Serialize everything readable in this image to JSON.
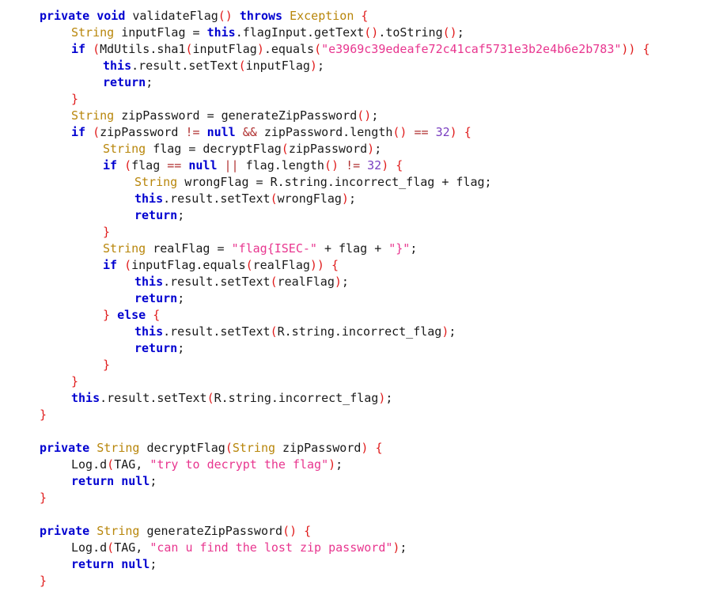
{
  "editor": {
    "language": "java",
    "background": "#ffffff",
    "colors": {
      "keyword": "#0000d0",
      "type": "#b8860b",
      "plain": "#1a1a1a",
      "bracket": "#e01b1b",
      "string": "#e8368f",
      "number": "#7a3fc0",
      "operator": "#b03030"
    }
  },
  "code": {
    "lines": [
      {
        "indent": 0,
        "tokens": [
          {
            "t": "private",
            "c": "kw"
          },
          {
            "t": " ",
            "c": "plain"
          },
          {
            "t": "void",
            "c": "kw"
          },
          {
            "t": " ",
            "c": "plain"
          },
          {
            "t": "validateFlag",
            "c": "plain"
          },
          {
            "t": "()",
            "c": "paren"
          },
          {
            "t": " ",
            "c": "plain"
          },
          {
            "t": "throws",
            "c": "kw"
          },
          {
            "t": " ",
            "c": "plain"
          },
          {
            "t": "Exception",
            "c": "type"
          },
          {
            "t": " ",
            "c": "plain"
          },
          {
            "t": "{",
            "c": "paren"
          }
        ]
      },
      {
        "indent": 1,
        "tokens": [
          {
            "t": "String",
            "c": "type"
          },
          {
            "t": " inputFlag ",
            "c": "plain"
          },
          {
            "t": "=",
            "c": "op"
          },
          {
            "t": " ",
            "c": "plain"
          },
          {
            "t": "this",
            "c": "kw"
          },
          {
            "t": ".flagInput.getText",
            "c": "plain"
          },
          {
            "t": "()",
            "c": "paren"
          },
          {
            "t": ".toString",
            "c": "plain"
          },
          {
            "t": "()",
            "c": "paren"
          },
          {
            "t": ";",
            "c": "op"
          }
        ]
      },
      {
        "indent": 1,
        "tokens": [
          {
            "t": "if",
            "c": "kw"
          },
          {
            "t": " ",
            "c": "plain"
          },
          {
            "t": "(",
            "c": "paren"
          },
          {
            "t": "MdUtils.sha1",
            "c": "plain"
          },
          {
            "t": "(",
            "c": "paren"
          },
          {
            "t": "inputFlag",
            "c": "plain"
          },
          {
            "t": ")",
            "c": "paren"
          },
          {
            "t": ".equals",
            "c": "plain"
          },
          {
            "t": "(",
            "c": "paren"
          },
          {
            "t": "\"e3969c39edeafe72c41caf5731e3b2e4b6e2b783\"",
            "c": "str"
          },
          {
            "t": "))",
            "c": "paren"
          },
          {
            "t": " ",
            "c": "plain"
          },
          {
            "t": "{",
            "c": "paren"
          }
        ]
      },
      {
        "indent": 2,
        "tokens": [
          {
            "t": "this",
            "c": "kw"
          },
          {
            "t": ".result.setText",
            "c": "plain"
          },
          {
            "t": "(",
            "c": "paren"
          },
          {
            "t": "inputFlag",
            "c": "plain"
          },
          {
            "t": ")",
            "c": "paren"
          },
          {
            "t": ";",
            "c": "op"
          }
        ]
      },
      {
        "indent": 2,
        "tokens": [
          {
            "t": "return",
            "c": "kw"
          },
          {
            "t": ";",
            "c": "op"
          }
        ]
      },
      {
        "indent": 1,
        "tokens": [
          {
            "t": "}",
            "c": "paren"
          }
        ]
      },
      {
        "indent": 1,
        "tokens": [
          {
            "t": "String",
            "c": "type"
          },
          {
            "t": " zipPassword ",
            "c": "plain"
          },
          {
            "t": "=",
            "c": "op"
          },
          {
            "t": " generateZipPassword",
            "c": "plain"
          },
          {
            "t": "()",
            "c": "paren"
          },
          {
            "t": ";",
            "c": "op"
          }
        ]
      },
      {
        "indent": 1,
        "tokens": [
          {
            "t": "if",
            "c": "kw"
          },
          {
            "t": " ",
            "c": "plain"
          },
          {
            "t": "(",
            "c": "paren"
          },
          {
            "t": "zipPassword ",
            "c": "plain"
          },
          {
            "t": "!=",
            "c": "opr"
          },
          {
            "t": " ",
            "c": "plain"
          },
          {
            "t": "null",
            "c": "kw"
          },
          {
            "t": " ",
            "c": "plain"
          },
          {
            "t": "&&",
            "c": "opr"
          },
          {
            "t": " zipPassword.length",
            "c": "plain"
          },
          {
            "t": "()",
            "c": "paren"
          },
          {
            "t": " ",
            "c": "plain"
          },
          {
            "t": "==",
            "c": "opr"
          },
          {
            "t": " ",
            "c": "plain"
          },
          {
            "t": "32",
            "c": "num"
          },
          {
            "t": ")",
            "c": "paren"
          },
          {
            "t": " ",
            "c": "plain"
          },
          {
            "t": "{",
            "c": "paren"
          }
        ]
      },
      {
        "indent": 2,
        "tokens": [
          {
            "t": "String",
            "c": "type"
          },
          {
            "t": " flag ",
            "c": "plain"
          },
          {
            "t": "=",
            "c": "op"
          },
          {
            "t": " decryptFlag",
            "c": "plain"
          },
          {
            "t": "(",
            "c": "paren"
          },
          {
            "t": "zipPassword",
            "c": "plain"
          },
          {
            "t": ")",
            "c": "paren"
          },
          {
            "t": ";",
            "c": "op"
          }
        ]
      },
      {
        "indent": 2,
        "tokens": [
          {
            "t": "if",
            "c": "kw"
          },
          {
            "t": " ",
            "c": "plain"
          },
          {
            "t": "(",
            "c": "paren"
          },
          {
            "t": "flag ",
            "c": "plain"
          },
          {
            "t": "==",
            "c": "opr"
          },
          {
            "t": " ",
            "c": "plain"
          },
          {
            "t": "null",
            "c": "kw"
          },
          {
            "t": " ",
            "c": "plain"
          },
          {
            "t": "||",
            "c": "opr"
          },
          {
            "t": " flag.length",
            "c": "plain"
          },
          {
            "t": "()",
            "c": "paren"
          },
          {
            "t": " ",
            "c": "plain"
          },
          {
            "t": "!=",
            "c": "opr"
          },
          {
            "t": " ",
            "c": "plain"
          },
          {
            "t": "32",
            "c": "num"
          },
          {
            "t": ")",
            "c": "paren"
          },
          {
            "t": " ",
            "c": "plain"
          },
          {
            "t": "{",
            "c": "paren"
          }
        ]
      },
      {
        "indent": 3,
        "tokens": [
          {
            "t": "String",
            "c": "type"
          },
          {
            "t": " wrongFlag ",
            "c": "plain"
          },
          {
            "t": "=",
            "c": "op"
          },
          {
            "t": " R.string.incorrect_flag ",
            "c": "plain"
          },
          {
            "t": "+",
            "c": "op"
          },
          {
            "t": " flag",
            "c": "plain"
          },
          {
            "t": ";",
            "c": "op"
          }
        ]
      },
      {
        "indent": 3,
        "tokens": [
          {
            "t": "this",
            "c": "kw"
          },
          {
            "t": ".result.setText",
            "c": "plain"
          },
          {
            "t": "(",
            "c": "paren"
          },
          {
            "t": "wrongFlag",
            "c": "plain"
          },
          {
            "t": ")",
            "c": "paren"
          },
          {
            "t": ";",
            "c": "op"
          }
        ]
      },
      {
        "indent": 3,
        "tokens": [
          {
            "t": "return",
            "c": "kw"
          },
          {
            "t": ";",
            "c": "op"
          }
        ]
      },
      {
        "indent": 2,
        "tokens": [
          {
            "t": "}",
            "c": "paren"
          }
        ]
      },
      {
        "indent": 2,
        "tokens": [
          {
            "t": "String",
            "c": "type"
          },
          {
            "t": " realFlag ",
            "c": "plain"
          },
          {
            "t": "=",
            "c": "op"
          },
          {
            "t": " ",
            "c": "plain"
          },
          {
            "t": "\"flag{ISEC-\"",
            "c": "str"
          },
          {
            "t": " ",
            "c": "plain"
          },
          {
            "t": "+",
            "c": "op"
          },
          {
            "t": " flag ",
            "c": "plain"
          },
          {
            "t": "+",
            "c": "op"
          },
          {
            "t": " ",
            "c": "plain"
          },
          {
            "t": "\"}\"",
            "c": "str"
          },
          {
            "t": ";",
            "c": "op"
          }
        ]
      },
      {
        "indent": 2,
        "tokens": [
          {
            "t": "if",
            "c": "kw"
          },
          {
            "t": " ",
            "c": "plain"
          },
          {
            "t": "(",
            "c": "paren"
          },
          {
            "t": "inputFlag.equals",
            "c": "plain"
          },
          {
            "t": "(",
            "c": "paren"
          },
          {
            "t": "realFlag",
            "c": "plain"
          },
          {
            "t": "))",
            "c": "paren"
          },
          {
            "t": " ",
            "c": "plain"
          },
          {
            "t": "{",
            "c": "paren"
          }
        ]
      },
      {
        "indent": 3,
        "tokens": [
          {
            "t": "this",
            "c": "kw"
          },
          {
            "t": ".result.setText",
            "c": "plain"
          },
          {
            "t": "(",
            "c": "paren"
          },
          {
            "t": "realFlag",
            "c": "plain"
          },
          {
            "t": ")",
            "c": "paren"
          },
          {
            "t": ";",
            "c": "op"
          }
        ]
      },
      {
        "indent": 3,
        "tokens": [
          {
            "t": "return",
            "c": "kw"
          },
          {
            "t": ";",
            "c": "op"
          }
        ]
      },
      {
        "indent": 2,
        "tokens": [
          {
            "t": "}",
            "c": "paren"
          },
          {
            "t": " ",
            "c": "plain"
          },
          {
            "t": "else",
            "c": "kw"
          },
          {
            "t": " ",
            "c": "plain"
          },
          {
            "t": "{",
            "c": "paren"
          }
        ]
      },
      {
        "indent": 3,
        "tokens": [
          {
            "t": "this",
            "c": "kw"
          },
          {
            "t": ".result.setText",
            "c": "plain"
          },
          {
            "t": "(",
            "c": "paren"
          },
          {
            "t": "R.string.incorrect_flag",
            "c": "plain"
          },
          {
            "t": ")",
            "c": "paren"
          },
          {
            "t": ";",
            "c": "op"
          }
        ]
      },
      {
        "indent": 3,
        "tokens": [
          {
            "t": "return",
            "c": "kw"
          },
          {
            "t": ";",
            "c": "op"
          }
        ]
      },
      {
        "indent": 2,
        "tokens": [
          {
            "t": "}",
            "c": "paren"
          }
        ]
      },
      {
        "indent": 1,
        "tokens": [
          {
            "t": "}",
            "c": "paren"
          }
        ]
      },
      {
        "indent": 1,
        "tokens": [
          {
            "t": "this",
            "c": "kw"
          },
          {
            "t": ".result.setText",
            "c": "plain"
          },
          {
            "t": "(",
            "c": "paren"
          },
          {
            "t": "R.string.incorrect_flag",
            "c": "plain"
          },
          {
            "t": ")",
            "c": "paren"
          },
          {
            "t": ";",
            "c": "op"
          }
        ]
      },
      {
        "indent": 0,
        "tokens": [
          {
            "t": "}",
            "c": "paren"
          }
        ]
      },
      {
        "indent": 0,
        "tokens": []
      },
      {
        "indent": 0,
        "tokens": [
          {
            "t": "private",
            "c": "kw"
          },
          {
            "t": " ",
            "c": "plain"
          },
          {
            "t": "String",
            "c": "type"
          },
          {
            "t": " decryptFlag",
            "c": "plain"
          },
          {
            "t": "(",
            "c": "paren"
          },
          {
            "t": "String",
            "c": "type"
          },
          {
            "t": " zipPassword",
            "c": "plain"
          },
          {
            "t": ")",
            "c": "paren"
          },
          {
            "t": " ",
            "c": "plain"
          },
          {
            "t": "{",
            "c": "paren"
          }
        ]
      },
      {
        "indent": 1,
        "tokens": [
          {
            "t": "Log.d",
            "c": "plain"
          },
          {
            "t": "(",
            "c": "paren"
          },
          {
            "t": "TAG",
            "c": "plain"
          },
          {
            "t": ",",
            "c": "op"
          },
          {
            "t": " ",
            "c": "plain"
          },
          {
            "t": "\"try to decrypt the flag\"",
            "c": "str"
          },
          {
            "t": ")",
            "c": "paren"
          },
          {
            "t": ";",
            "c": "op"
          }
        ]
      },
      {
        "indent": 1,
        "tokens": [
          {
            "t": "return",
            "c": "kw"
          },
          {
            "t": " ",
            "c": "plain"
          },
          {
            "t": "null",
            "c": "kw"
          },
          {
            "t": ";",
            "c": "op"
          }
        ]
      },
      {
        "indent": 0,
        "tokens": [
          {
            "t": "}",
            "c": "paren"
          }
        ]
      },
      {
        "indent": 0,
        "tokens": []
      },
      {
        "indent": 0,
        "tokens": [
          {
            "t": "private",
            "c": "kw"
          },
          {
            "t": " ",
            "c": "plain"
          },
          {
            "t": "String",
            "c": "type"
          },
          {
            "t": " generateZipPassword",
            "c": "plain"
          },
          {
            "t": "()",
            "c": "paren"
          },
          {
            "t": " ",
            "c": "plain"
          },
          {
            "t": "{",
            "c": "paren"
          }
        ]
      },
      {
        "indent": 1,
        "tokens": [
          {
            "t": "Log.d",
            "c": "plain"
          },
          {
            "t": "(",
            "c": "paren"
          },
          {
            "t": "TAG",
            "c": "plain"
          },
          {
            "t": ",",
            "c": "op"
          },
          {
            "t": " ",
            "c": "plain"
          },
          {
            "t": "\"can u find the lost zip password\"",
            "c": "str"
          },
          {
            "t": ")",
            "c": "paren"
          },
          {
            "t": ";",
            "c": "op"
          }
        ]
      },
      {
        "indent": 1,
        "tokens": [
          {
            "t": "return",
            "c": "kw"
          },
          {
            "t": " ",
            "c": "plain"
          },
          {
            "t": "null",
            "c": "kw"
          },
          {
            "t": ";",
            "c": "op"
          }
        ]
      },
      {
        "indent": 0,
        "tokens": [
          {
            "t": "}",
            "c": "paren"
          }
        ]
      }
    ]
  }
}
